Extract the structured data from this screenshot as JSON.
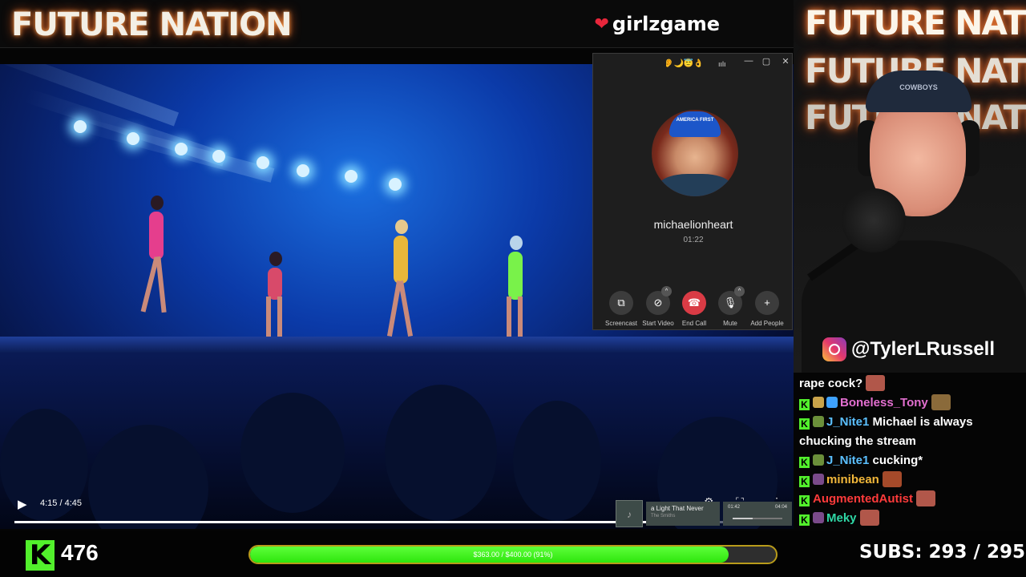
{
  "header": {
    "brand": "FUTURE NATION",
    "site": "girlzgame"
  },
  "video": {
    "time": "4:15 / 4:45",
    "progress": 0.89
  },
  "call": {
    "emojis": "👂🌙😇👌",
    "signal": "ıılı",
    "caller": "michaelionheart",
    "duration": "01:22",
    "cap_text": "AMERICA FIRST",
    "buttons": [
      {
        "label": "Screencast",
        "icon": "⧉"
      },
      {
        "label": "Start Video",
        "icon": "⊘"
      },
      {
        "label": "End Call",
        "icon": "☎"
      },
      {
        "label": "Mute",
        "icon": "🎙"
      },
      {
        "label": "Add People",
        "icon": "+"
      }
    ]
  },
  "mini_player": {
    "title": "a Light That Never",
    "artist": "The Smiths",
    "time_elapsed": "01:42",
    "time_total": "04:04"
  },
  "bottom": {
    "viewers": "476",
    "goal_text": "$363.00 / $400.00 (91%)",
    "goal_fraction": 0.91,
    "subs": "SUBS:  293 / 295"
  },
  "cam": {
    "bg_text": "FUTURE NATION",
    "cap_text": "COWBOYS",
    "handle": "@TylerLRussell"
  },
  "chat": {
    "messages": [
      {
        "user": "",
        "text": "rape cock?",
        "color": "#ffffff"
      },
      {
        "user": "Boneless_Tony",
        "text": "",
        "color": "#e36fd0"
      },
      {
        "user": "J_Nite1",
        "text": "Michael is always chucking the stream",
        "color": "#5bc0ff"
      },
      {
        "user": "J_Nite1",
        "text": "cucking*",
        "color": "#5bc0ff"
      },
      {
        "user": "minibean",
        "text": "",
        "color": "#f2b73a"
      },
      {
        "user": "AugmentedAutist",
        "text": "",
        "color": "#ff3b3b"
      },
      {
        "user": "Meky",
        "text": "",
        "color": "#2fd7a6"
      }
    ]
  }
}
